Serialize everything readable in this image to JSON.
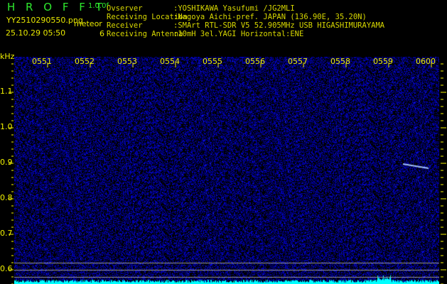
{
  "header": {
    "app": "H R O F F T",
    "version": "1.0.0f",
    "filename": "YY2510290550.png",
    "datetime": "25.10.29 05:50",
    "meteor_label": "meteor",
    "meteor_count": "6"
  },
  "info": [
    {
      "key": "Ovserver",
      "value": ":YOSHIKAWA Yasufumi /JG2MLI"
    },
    {
      "key": "Receiving Location",
      "value": ":Nagoya Aichi-pref. JAPAN (136.90E, 35.20N)"
    },
    {
      "key": "Receiver",
      "value": ":SMArt RTL-SDR V5 52.905MHz USB HIGASHIMURAYAMA"
    },
    {
      "key": "Receiving Antenna",
      "value": ":10mH 3el.YAGI Horizontal:ENE"
    }
  ],
  "colors": {
    "text_green": "#2ee82e",
    "text_yellow": "#e8e800",
    "noise": "#1010a0",
    "level": "#00ffff"
  },
  "chart_data": {
    "type": "heatmap",
    "ylabel": "kHz",
    "ylim": [
      0.56,
      1.2
    ],
    "x_ticks": [
      "0551",
      "0552",
      "0553",
      "0554",
      "0555",
      "0556",
      "0557",
      "0558",
      "0559",
      "0600"
    ],
    "y_ticks": [
      "1.1",
      "1.0",
      "0.9",
      "0.8",
      "0.7",
      "0.6"
    ],
    "echoes": [
      {
        "time_min": 8.2,
        "freq_khz": 0.89,
        "duration_min": 0.6
      }
    ]
  }
}
